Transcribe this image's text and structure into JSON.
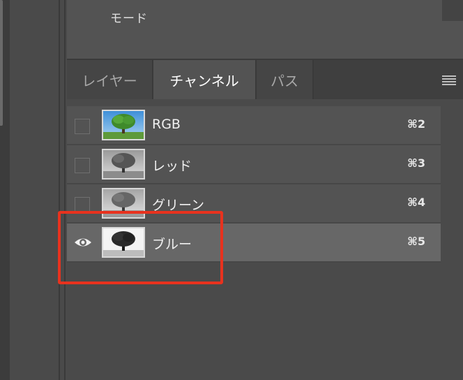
{
  "top_panel": {
    "mode_label": "モード"
  },
  "tabs": [
    {
      "label": "レイヤー",
      "active": false
    },
    {
      "label": "チャンネル",
      "active": true
    },
    {
      "label": "パス",
      "active": false
    }
  ],
  "panel_menu_icon": "hamburger-menu-icon",
  "channels": [
    {
      "name": "RGB",
      "shortcut": "⌘2",
      "visible": false,
      "thumbnail": "color-tree",
      "selected": false
    },
    {
      "name": "レッド",
      "shortcut": "⌘3",
      "visible": false,
      "thumbnail": "gray-tree-light",
      "selected": false
    },
    {
      "name": "グリーン",
      "shortcut": "⌘4",
      "visible": false,
      "thumbnail": "gray-tree-light",
      "selected": false
    },
    {
      "name": "ブルー",
      "shortcut": "⌘5",
      "visible": true,
      "thumbnail": "gray-tree-dark",
      "selected": true
    }
  ],
  "colors": {
    "panel_bg": "#535353",
    "selected_row": "#676767",
    "highlight_box": "#e8321e"
  }
}
